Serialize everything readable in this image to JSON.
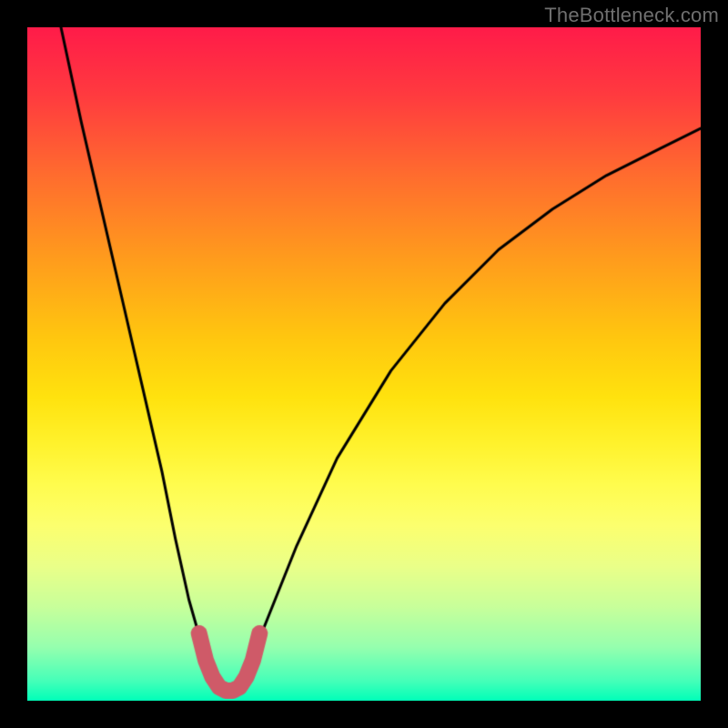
{
  "watermark": "TheBottleneck.com",
  "chart_data": {
    "type": "line",
    "title": "",
    "xlabel": "",
    "ylabel": "",
    "xlim": [
      0,
      100
    ],
    "ylim": [
      0,
      100
    ],
    "grid": false,
    "legend": false,
    "series": [
      {
        "name": "bottleneck-curve",
        "color": "#000000",
        "x": [
          5,
          8,
          11,
          14,
          17,
          20,
          22,
          24,
          26,
          27,
          28,
          29,
          30,
          31,
          32,
          33,
          34,
          36,
          40,
          46,
          54,
          62,
          70,
          78,
          86,
          94,
          100
        ],
        "y": [
          100,
          86,
          73,
          60,
          47,
          34,
          24,
          15,
          8,
          5,
          3,
          2,
          1.5,
          2,
          3,
          5,
          8,
          13,
          23,
          36,
          49,
          59,
          67,
          73,
          78,
          82,
          85
        ]
      },
      {
        "name": "valley-highlight",
        "color": "#cf5a68",
        "x": [
          25.5,
          26.5,
          27.5,
          28.5,
          29.5,
          30.5,
          31.5,
          32.5,
          33.5,
          34.5
        ],
        "y": [
          10,
          6,
          3.5,
          2,
          1.5,
          1.5,
          2,
          3.5,
          6,
          10
        ]
      }
    ],
    "gradient_background": {
      "direction": "vertical",
      "stops": [
        {
          "pos": 0.0,
          "color": "#ff1b49"
        },
        {
          "pos": 0.5,
          "color": "#ffe20e"
        },
        {
          "pos": 0.8,
          "color": "#eaff88"
        },
        {
          "pos": 1.0,
          "color": "#00ffb8"
        }
      ]
    }
  }
}
